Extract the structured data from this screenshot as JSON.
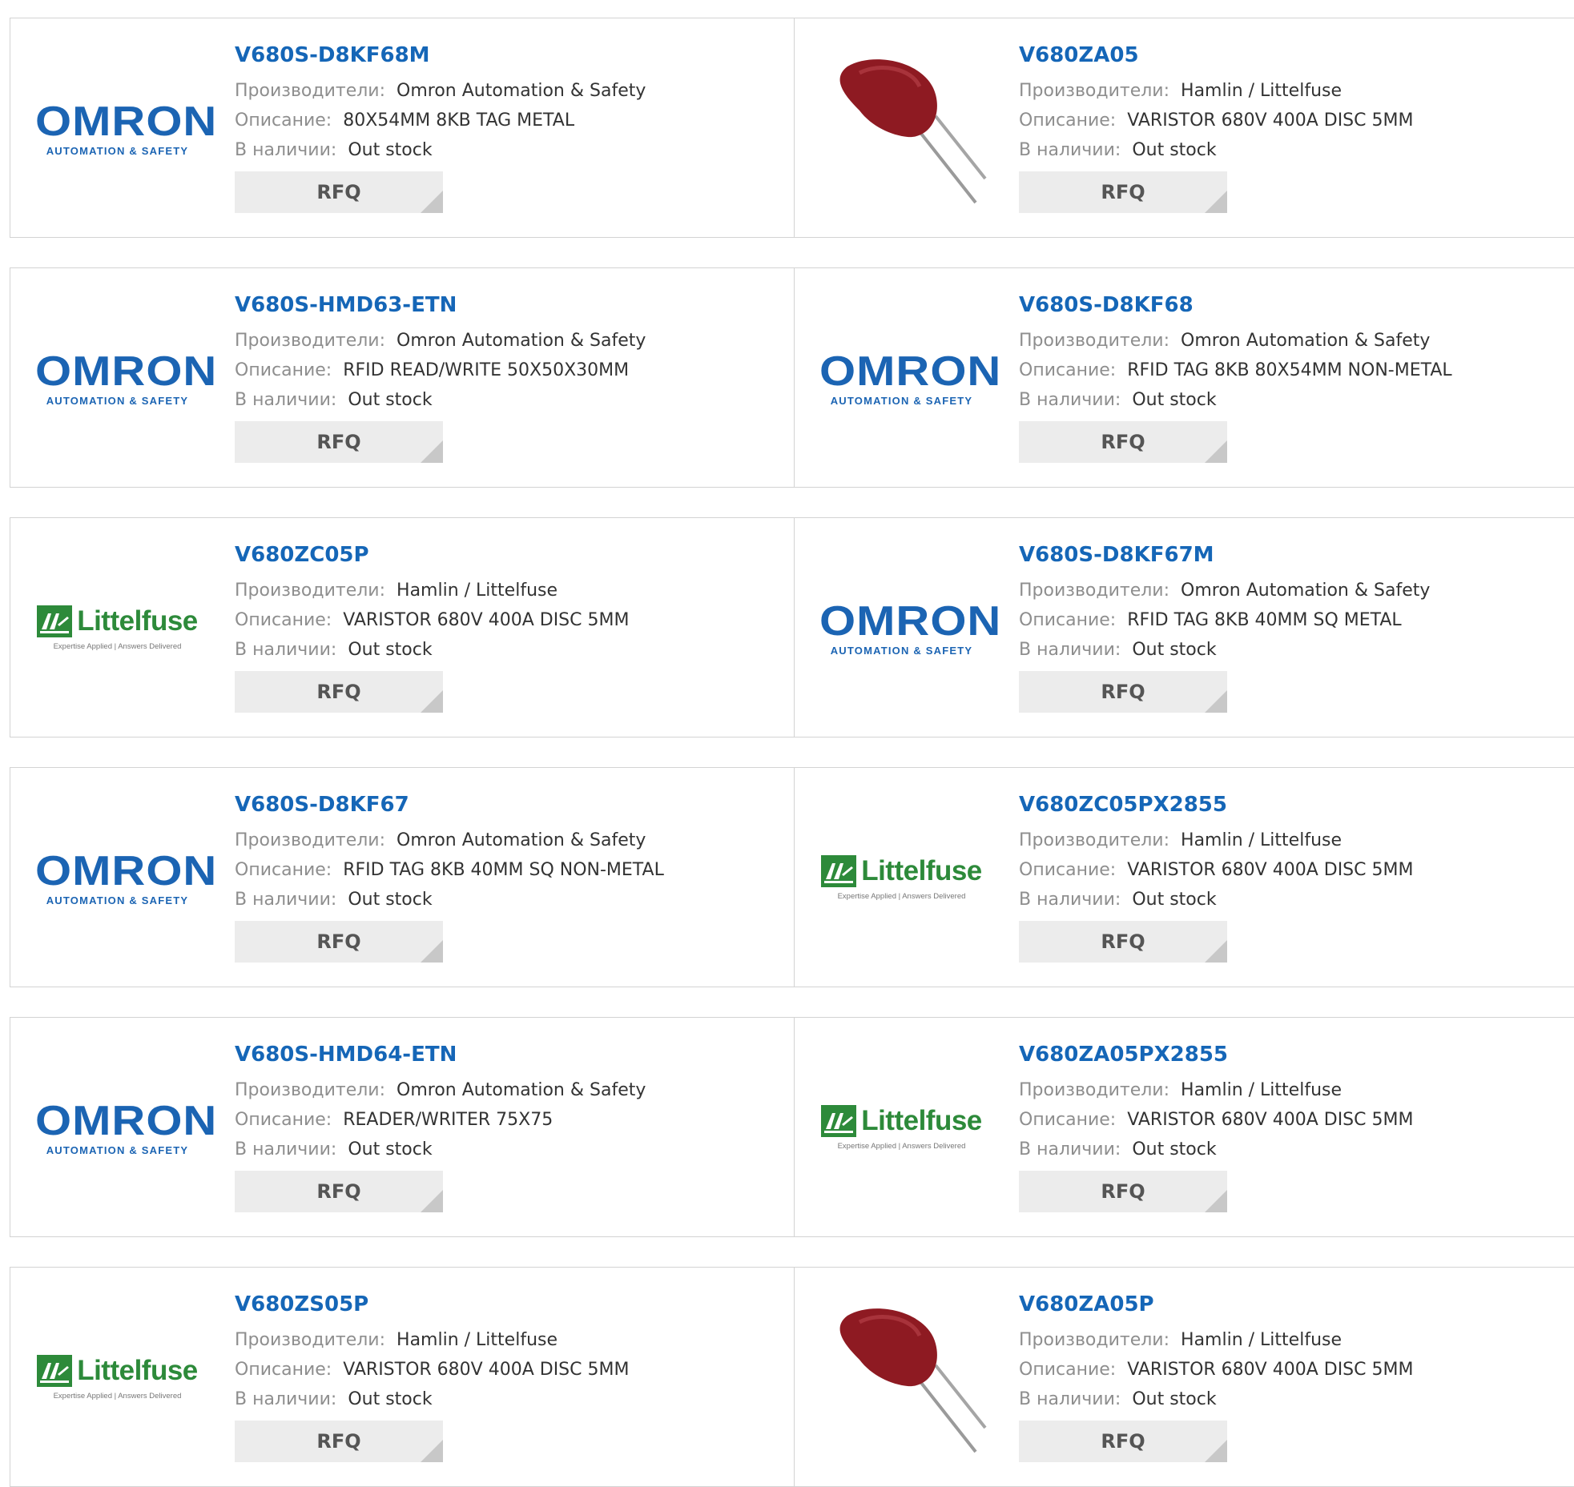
{
  "labels": {
    "manufacturer": "Производители:",
    "description": "Описание:",
    "stock": "В наличии:",
    "rfq": "RFQ"
  },
  "logos": {
    "omron_word": "OMRON",
    "omron_sub": "AUTOMATION & SAFETY",
    "littelfuse_word": "Littelfuse",
    "littelfuse_tag": "Expertise Applied | Answers Delivered"
  },
  "colors": {
    "part_link": "#1566b7",
    "omron_blue": "#1b64b3",
    "littelfuse_green": "#2d8a3a",
    "varistor_red": "#8e1a22"
  },
  "rows": [
    [
      {
        "part": "V680S-D8KF68M",
        "logo": "omron",
        "manufacturer": "Omron Automation & Safety",
        "description": "80X54MM 8KB TAG METAL",
        "stock": "Out stock"
      },
      {
        "part": "V680ZA05",
        "logo": "varistor",
        "manufacturer": "Hamlin / Littelfuse",
        "description": "VARISTOR 680V 400A DISC 5MM",
        "stock": "Out stock"
      }
    ],
    [
      {
        "part": "V680S-HMD63-ETN",
        "logo": "omron",
        "manufacturer": "Omron Automation & Safety",
        "description": "RFID READ/WRITE 50X50X30MM",
        "stock": "Out stock"
      },
      {
        "part": "V680S-D8KF68",
        "logo": "omron",
        "manufacturer": "Omron Automation & Safety",
        "description": "RFID TAG 8KB 80X54MM NON-METAL",
        "stock": "Out stock"
      }
    ],
    [
      {
        "part": "V680ZC05P",
        "logo": "littelfuse",
        "manufacturer": "Hamlin / Littelfuse",
        "description": "VARISTOR 680V 400A DISC 5MM",
        "stock": "Out stock"
      },
      {
        "part": "V680S-D8KF67M",
        "logo": "omron",
        "manufacturer": "Omron Automation & Safety",
        "description": "RFID TAG 8KB 40MM SQ METAL",
        "stock": "Out stock"
      }
    ],
    [
      {
        "part": "V680S-D8KF67",
        "logo": "omron",
        "manufacturer": "Omron Automation & Safety",
        "description": "RFID TAG 8KB 40MM SQ NON-METAL",
        "stock": "Out stock"
      },
      {
        "part": "V680ZC05PX2855",
        "logo": "littelfuse",
        "manufacturer": "Hamlin / Littelfuse",
        "description": "VARISTOR 680V 400A DISC 5MM",
        "stock": "Out stock"
      }
    ],
    [
      {
        "part": "V680S-HMD64-ETN",
        "logo": "omron",
        "manufacturer": "Omron Automation & Safety",
        "description": "READER/WRITER 75X75",
        "stock": "Out stock"
      },
      {
        "part": "V680ZA05PX2855",
        "logo": "littelfuse",
        "manufacturer": "Hamlin / Littelfuse",
        "description": "VARISTOR 680V 400A DISC 5MM",
        "stock": "Out stock"
      }
    ],
    [
      {
        "part": "V680ZS05P",
        "logo": "littelfuse",
        "manufacturer": "Hamlin / Littelfuse",
        "description": "VARISTOR 680V 400A DISC 5MM",
        "stock": "Out stock"
      },
      {
        "part": "V680ZA05P",
        "logo": "varistor",
        "manufacturer": "Hamlin / Littelfuse",
        "description": "VARISTOR 680V 400A DISC 5MM",
        "stock": "Out stock"
      }
    ]
  ]
}
